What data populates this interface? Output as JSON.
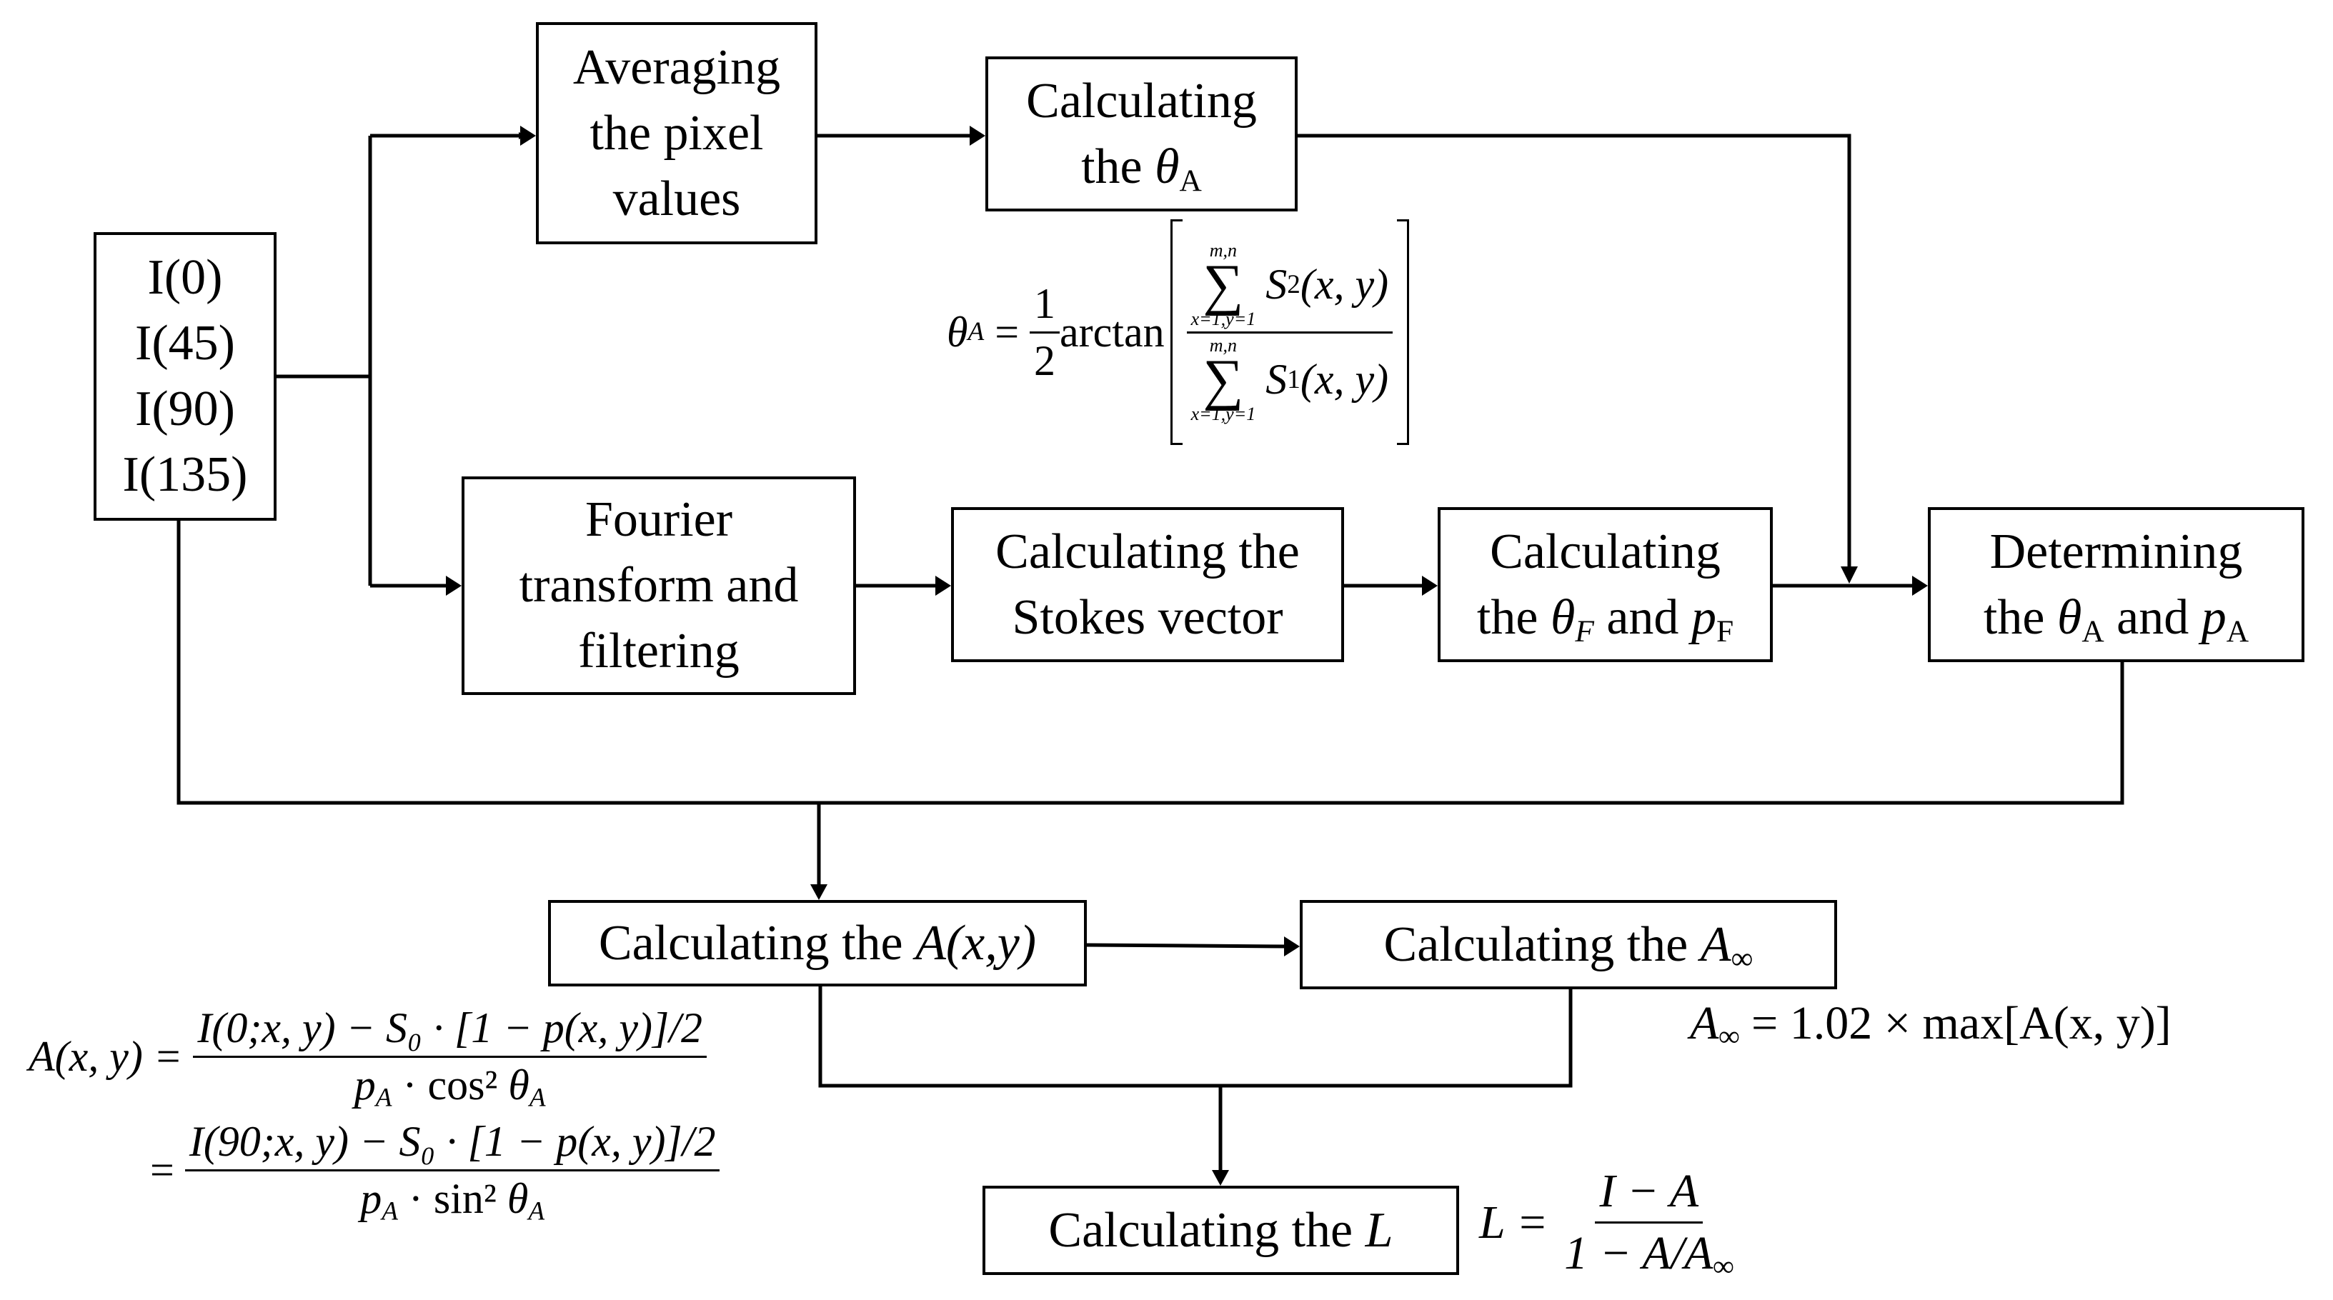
{
  "diagram": {
    "type": "flowchart",
    "nodes": {
      "inputs": {
        "lines": [
          "I(0)",
          "I(45)",
          "I(90)",
          "I(135)"
        ]
      },
      "averaging": {
        "lines": [
          "Averaging",
          "the pixel",
          "values"
        ]
      },
      "calc_theta_a": {
        "line1": "Calculating",
        "line2_prefix": "the ",
        "symbol": "θ",
        "symbol_sub": "A"
      },
      "fourier": {
        "lines": [
          "Fourier",
          "transform and",
          "filtering"
        ]
      },
      "stokes": {
        "lines": [
          "Calculating the",
          "Stokes vector"
        ]
      },
      "calc_theta_f": {
        "line1": "Calculating",
        "line2_prefix": "the ",
        "symbol1": "θ",
        "symbol1_sub": "F",
        "conj": " and ",
        "symbol2": "p",
        "symbol2_sub": "F"
      },
      "determining": {
        "line1": "Determining",
        "line2_prefix": "the ",
        "symbol1": "θ",
        "symbol1_sub": "A",
        "conj": " and ",
        "symbol2": "p",
        "symbol2_sub": "A"
      },
      "calc_a": {
        "prefix": "Calculating the ",
        "symbol": "A(x,y)"
      },
      "calc_a_inf": {
        "prefix": "Calculating the ",
        "symbol": "A",
        "symbol_sub": "∞"
      },
      "calc_l": {
        "prefix": "Calculating the ",
        "symbol": "L"
      }
    },
    "edges": [
      [
        "inputs",
        "averaging"
      ],
      [
        "inputs",
        "fourier"
      ],
      [
        "averaging",
        "calc_theta_a"
      ],
      [
        "calc_theta_a",
        "determining"
      ],
      [
        "fourier",
        "stokes"
      ],
      [
        "stokes",
        "calc_theta_f"
      ],
      [
        "calc_theta_f",
        "determining"
      ],
      [
        "inputs",
        "calc_a"
      ],
      [
        "determining",
        "calc_a"
      ],
      [
        "calc_a",
        "calc_a_inf"
      ],
      [
        "calc_a",
        "calc_l"
      ],
      [
        "calc_a_inf",
        "calc_l"
      ]
    ],
    "formulas": {
      "theta_a": {
        "lhs": "θ",
        "lhs_sub": "A",
        "eq": " = ",
        "half_num": "1",
        "half_den": "2",
        "func": "arctan",
        "upper_limit": "m,n",
        "lower_limit": "x=1,y=1",
        "num_term": "S",
        "num_sub": "2",
        "den_term": "S",
        "den_sub": "1",
        "args": "(x, y)"
      },
      "a_xy": {
        "lhs": "A(x, y) = ",
        "num1": "I(0;x, y) − S₀ · [1 − p(x, y)]/2",
        "den1": "p_A · cos² θ_A",
        "den1_p": "p",
        "den1_p_sub": "A",
        "den1_fn": " · cos² ",
        "den1_theta": "θ",
        "den1_theta_sub": "A",
        "eq2": "= ",
        "num2": "I(90;x, y) − S₀ · [1 − p(x, y)]/2",
        "den2_p": "p",
        "den2_p_sub": "A",
        "den2_fn": " · sin² ",
        "den2_theta": "θ",
        "den2_theta_sub": "A"
      },
      "a_inf": {
        "lhs": "A",
        "lhs_sub": "∞",
        "rhs": " = 1.02 × max[A(x, y)]"
      },
      "l": {
        "lhs": "L = ",
        "num": "I − A",
        "den_prefix": "1 − A/A",
        "den_sub": "∞"
      }
    }
  }
}
